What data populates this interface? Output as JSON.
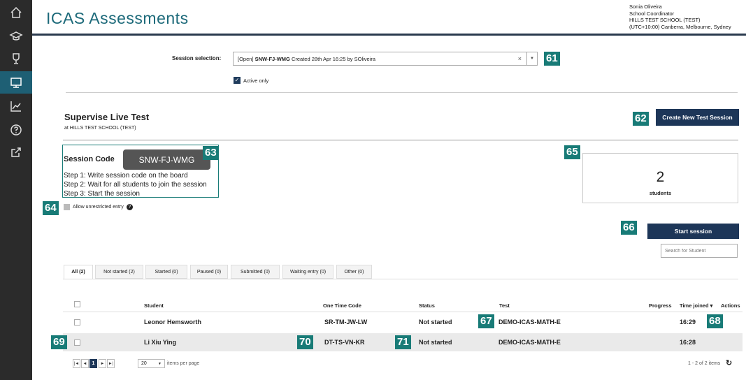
{
  "app": {
    "title": "ICAS Assessments"
  },
  "user": {
    "name": "Sonia Oliveira",
    "role": "School Coordinator",
    "school": "HILLS TEST SCHOOL (TEST)",
    "timezone": "(UTC+10:00) Canberra, Melbourne, Sydney"
  },
  "sidebar": {
    "icons": [
      "home-icon",
      "graduation-cap-icon",
      "trophy-icon",
      "monitor-icon",
      "chart-icon",
      "help-icon",
      "external-link-icon"
    ],
    "active": "monitor-icon"
  },
  "session": {
    "label": "Session selection:",
    "value_prefix": "[Open] ",
    "value_code": "SNW-FJ-WMG",
    "value_suffix": " Created 28th Apr 16:25 by SOliveira",
    "clear": "×",
    "arrow": "▼",
    "active_only_label": "Active only",
    "active_only_checked": true
  },
  "supervise": {
    "title": "Supervise Live Test",
    "subtitle": "at HILLS TEST SCHOOL (TEST)",
    "create_button": "Create New Test Session",
    "code_label": "Session Code",
    "code": "SNW-FJ-WMG",
    "steps": [
      "Step 1: Write session code on the board",
      "Step 2: Wait for all students to join the session",
      "Step 3: Start the session"
    ],
    "unrestricted_label": "Allow unrestricted entry",
    "help": "?",
    "student_count": "2",
    "student_count_label": "students",
    "start_button": "Start session",
    "search_placeholder": "Search for Student"
  },
  "tabs": [
    {
      "label": "All (2)",
      "active": true
    },
    {
      "label": "Not started (2)"
    },
    {
      "label": "Started (0)"
    },
    {
      "label": "Paused (0)"
    },
    {
      "label": "Submitted (0)"
    },
    {
      "label": "Waiting entry (0)"
    },
    {
      "label": "Other (0)"
    }
  ],
  "table": {
    "headers": {
      "student": "Student",
      "otc": "One Time Code",
      "status": "Status",
      "test": "Test",
      "progress": "Progress",
      "time_joined": "Time joined ▾",
      "actions": "Actions"
    },
    "rows": [
      {
        "student": "Leonor Hemsworth",
        "otc": "SR-TM-JW-LW",
        "status": "Not started",
        "test": "DEMO-ICAS-MATH-E",
        "time": "16:29"
      },
      {
        "student": "Li Xiu Ying",
        "otc": "DT-TS-VN-KR",
        "status": "Not started",
        "test": "DEMO-ICAS-MATH-E",
        "time": "16:28"
      }
    ]
  },
  "pager": {
    "first": "|◄",
    "prev": "◄",
    "page": "1",
    "next": "►",
    "last": "►|",
    "page_size": "20",
    "page_size_arrow": "▼",
    "per_page_label": "items per page",
    "summary": "1 - 2 of 2 items",
    "refresh": "↻"
  },
  "badges": [
    "61",
    "62",
    "63",
    "64",
    "65",
    "66",
    "67",
    "68",
    "69",
    "70",
    "71"
  ],
  "colors": {
    "badge": "#187b77",
    "primary": "#1d3658",
    "sidebar": "#2b2b2b",
    "active_nav": "#1e5f74",
    "title": "#1d6a7a"
  }
}
